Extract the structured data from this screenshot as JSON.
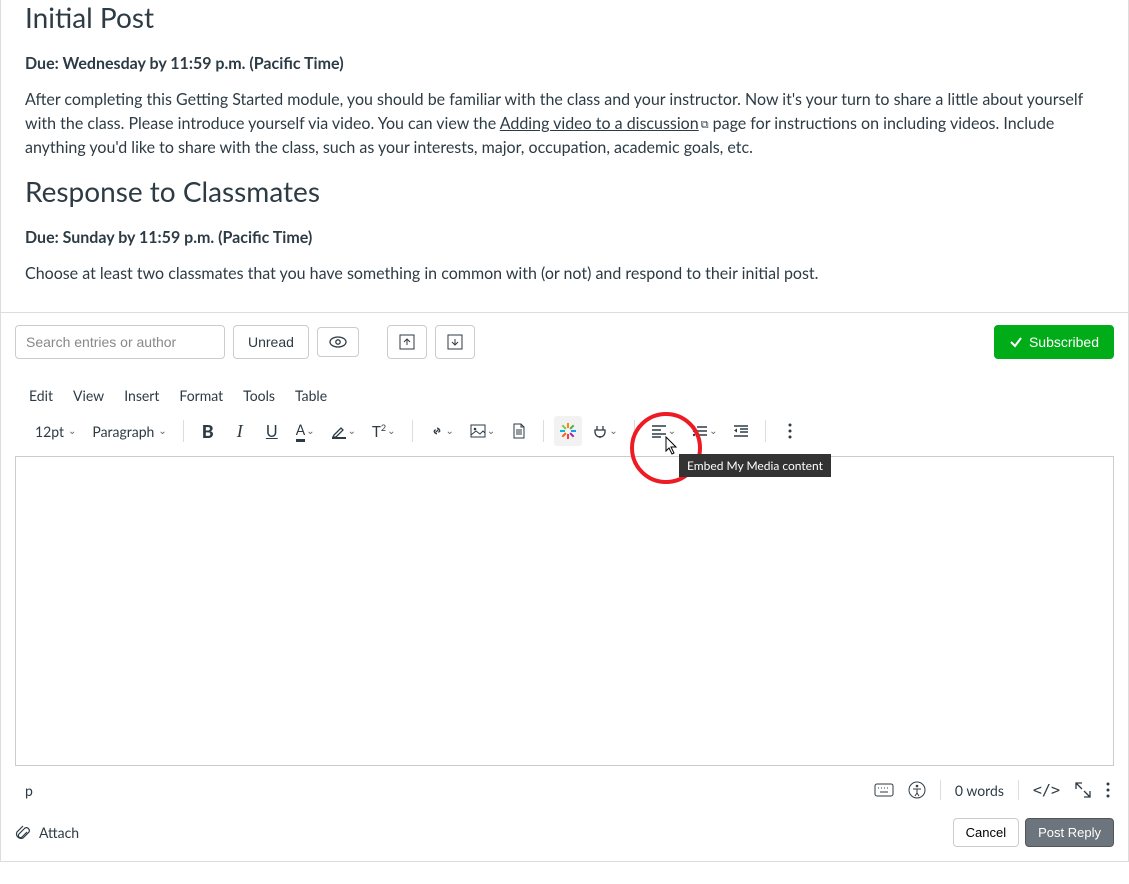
{
  "content": {
    "h1": "Initial Post",
    "due1": "Due: Wednesday by 11:59 p.m. (Pacific Time)",
    "p1a": "After completing this Getting Started module, you should be familiar with the class and your instructor. Now it's your turn to share a little about yourself with the class. Please introduce yourself via video. You can view the ",
    "link1": "Adding video to a discussion",
    "p1b": " page for instructions on including videos. Include anything you'd like to share with the class, such as your interests, major, occupation, academic goals, etc.",
    "h2": "Response to Classmates",
    "due2": "Due: Sunday by 11:59 p.m. (Pacific Time)",
    "p2": "Choose at least two classmates that you have something in common with (or not) and respond to their initial post."
  },
  "toolbar": {
    "search_placeholder": "Search entries or author",
    "unread": "Unread",
    "subscribed": "Subscribed"
  },
  "menu": {
    "edit": "Edit",
    "view": "View",
    "insert": "Insert",
    "format": "Format",
    "tools": "Tools",
    "table": "Table"
  },
  "format": {
    "size": "12pt",
    "para": "Paragraph"
  },
  "tooltip": "Embed My Media content",
  "status": {
    "path": "p",
    "words": "0 words",
    "html": "</>"
  },
  "footer": {
    "attach": "Attach",
    "cancel": "Cancel",
    "post": "Post Reply"
  },
  "colors": {
    "accent": "#00ac18",
    "annotation": "#ed1c24"
  }
}
